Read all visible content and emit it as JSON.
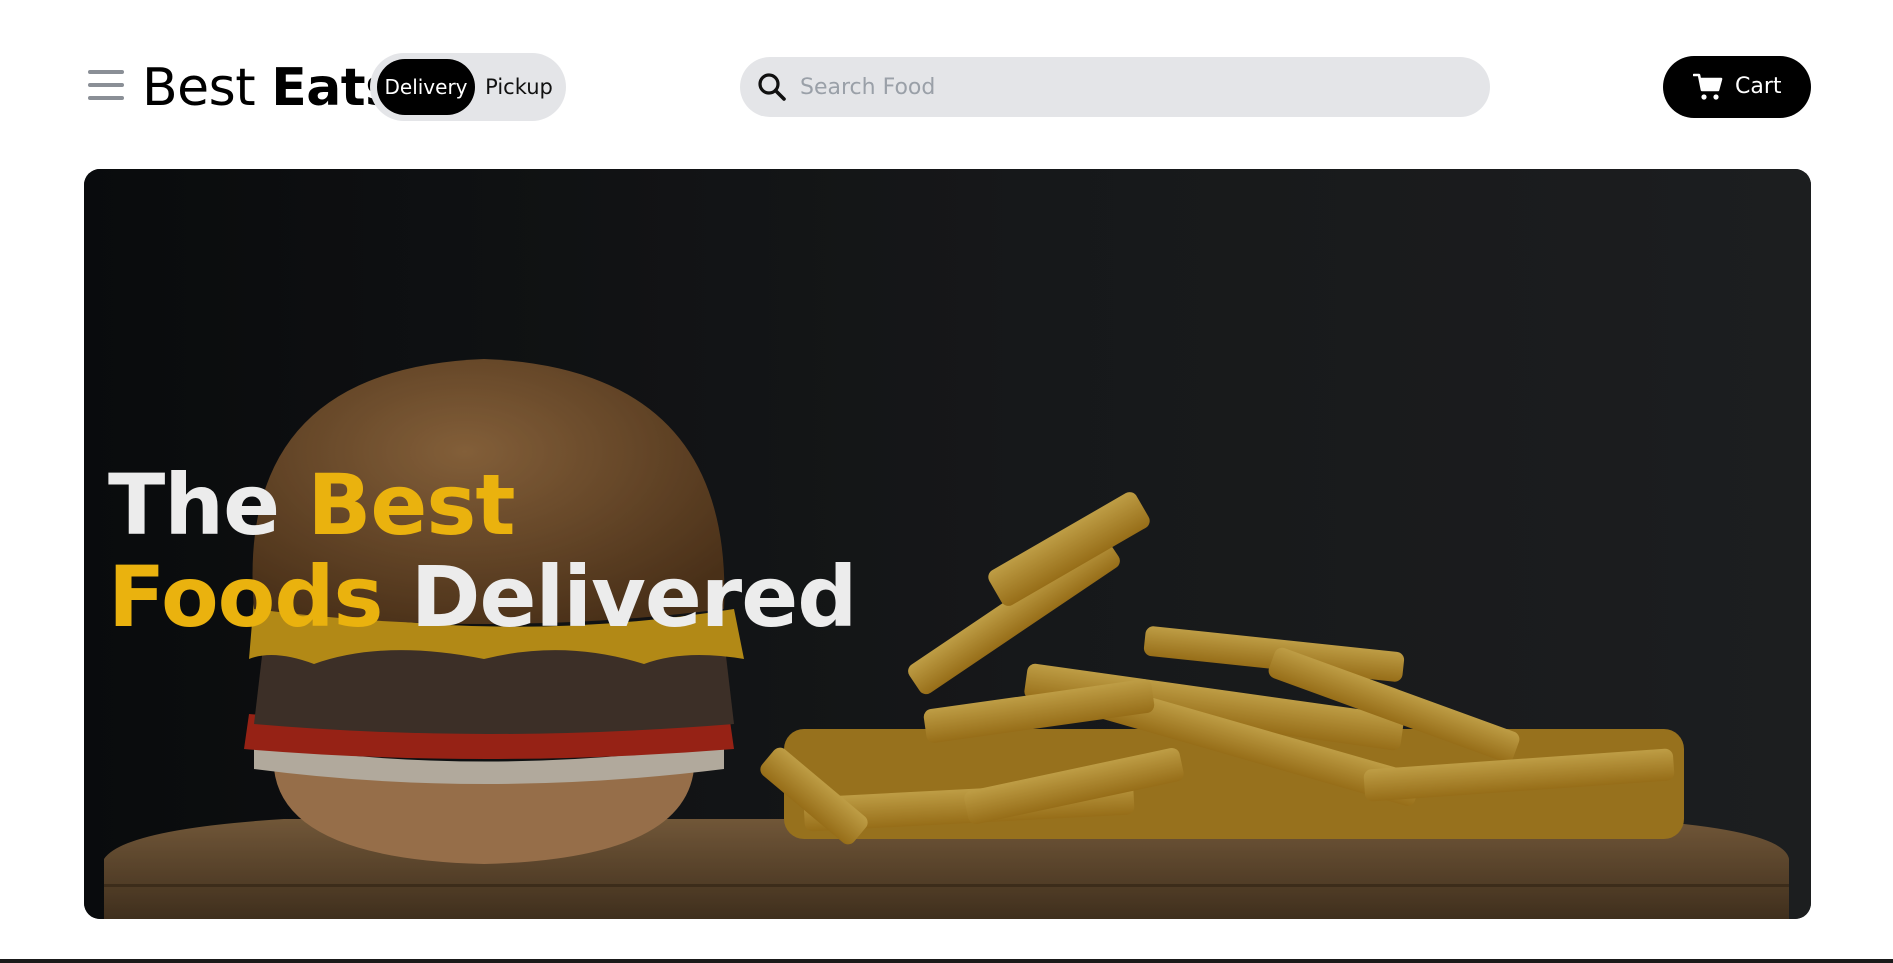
{
  "brand": {
    "name_light": "Best",
    "name_bold": "Eats"
  },
  "menu": {
    "icon": "hamburger-menu-icon"
  },
  "mode_toggle": {
    "options": [
      {
        "label": "Delivery",
        "selected": true
      },
      {
        "label": "Pickup",
        "selected": false
      }
    ]
  },
  "search": {
    "placeholder": "Search Food",
    "value": "",
    "icon": "search-icon"
  },
  "cart": {
    "label": "Cart",
    "icon": "cart-icon"
  },
  "hero": {
    "title_line1": {
      "word1": "The",
      "word2": "Best"
    },
    "title_line2": {
      "word1": "Foods",
      "word2": "Delivered"
    },
    "image": "burger-and-fries-photo"
  },
  "colors": {
    "accent": "#eab20e",
    "text_light": "#ececec",
    "button_dark": "#000000",
    "pill_bg": "#e4e5e8",
    "hero_bg": "#131517"
  }
}
